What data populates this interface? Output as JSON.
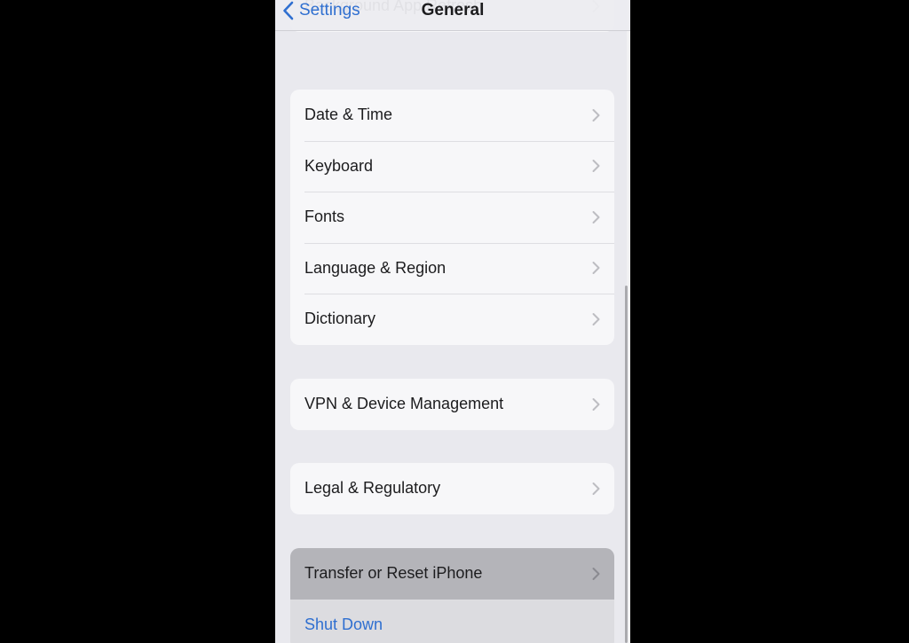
{
  "navbar": {
    "back_label": "Settings",
    "title": "General"
  },
  "groups": [
    {
      "items": [
        {
          "label": "Background App Refresh",
          "icon": "chevron-right-icon"
        }
      ]
    },
    {
      "items": [
        {
          "label": "Date & Time",
          "icon": "chevron-right-icon"
        },
        {
          "label": "Keyboard",
          "icon": "chevron-right-icon"
        },
        {
          "label": "Fonts",
          "icon": "chevron-right-icon"
        },
        {
          "label": "Language & Region",
          "icon": "chevron-right-icon"
        },
        {
          "label": "Dictionary",
          "icon": "chevron-right-icon"
        }
      ]
    },
    {
      "items": [
        {
          "label": "VPN & Device Management",
          "icon": "chevron-right-icon"
        }
      ]
    },
    {
      "items": [
        {
          "label": "Legal & Regulatory",
          "icon": "chevron-right-icon"
        }
      ]
    },
    {
      "items": [
        {
          "label": "Transfer or Reset iPhone",
          "icon": "chevron-right-icon",
          "state": "pressed"
        },
        {
          "label": "Shut Down",
          "style": "link"
        }
      ]
    }
  ],
  "colors": {
    "accent": "#2f6fd0",
    "background": "#e9e9ee",
    "cell": "#f7f7f9",
    "pressed": "#b4b4b9"
  }
}
